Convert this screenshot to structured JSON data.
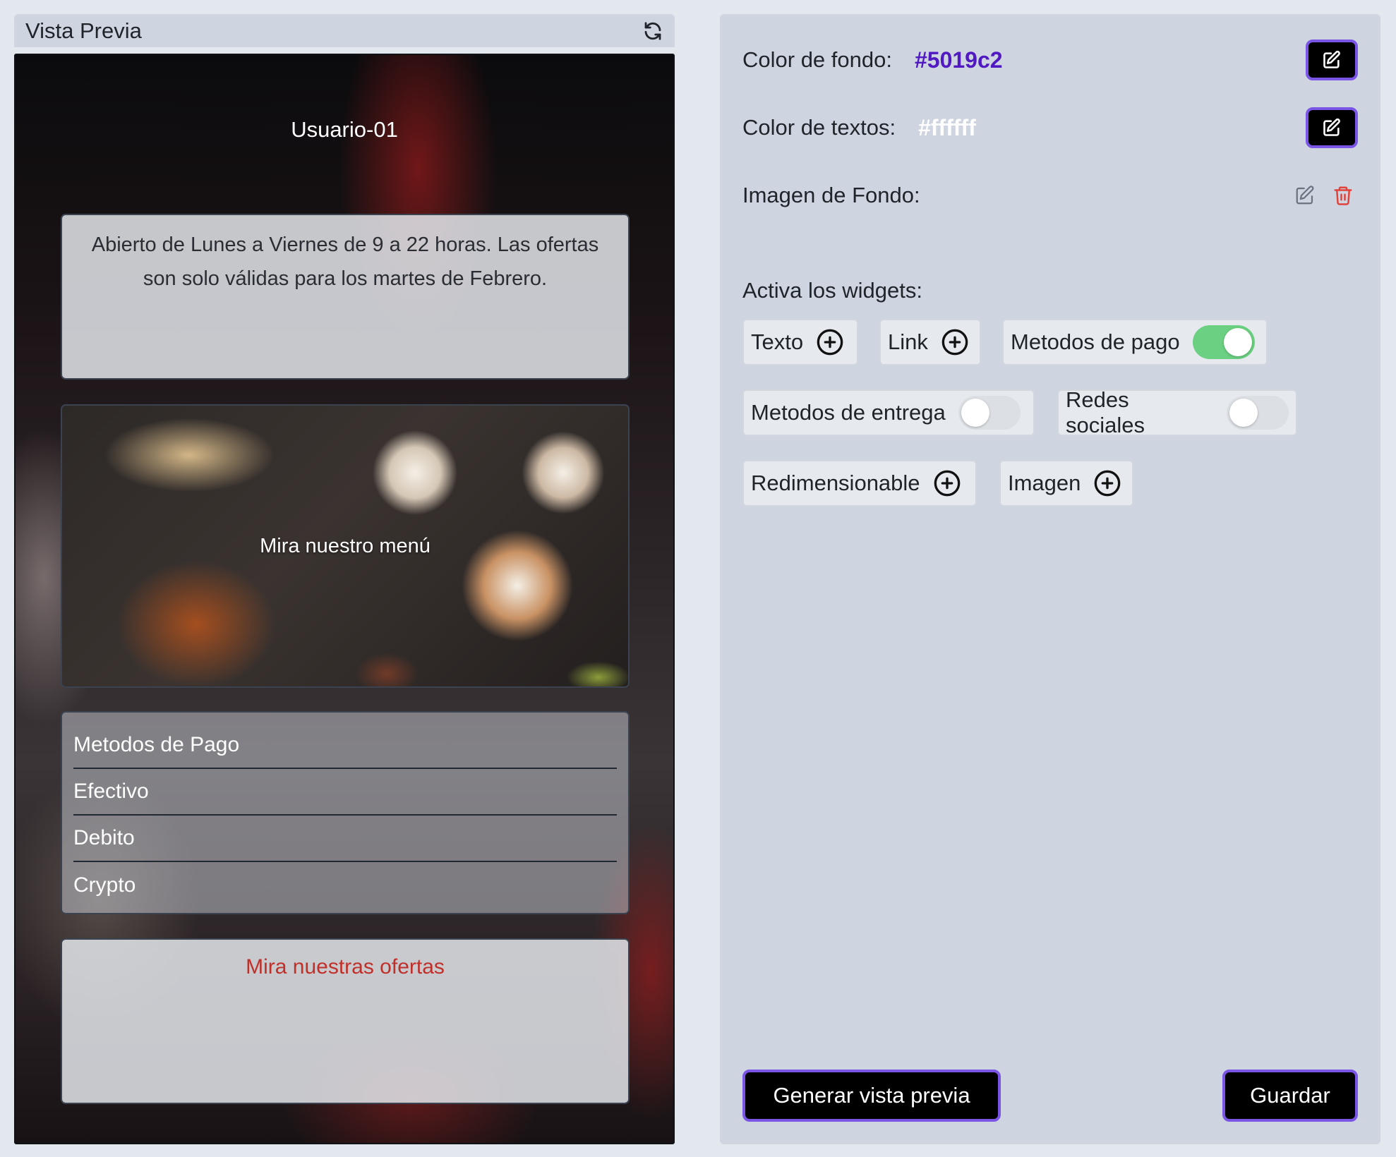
{
  "preview": {
    "title": "Vista Previa",
    "username": "Usuario-01",
    "text_widget": "Abierto de Lunes a Viernes de 9 a 22 horas. Las ofertas son solo válidas para los martes de Febrero.",
    "menu_widget": "Mira nuestro menú",
    "payments": [
      "Metodos de Pago",
      "Efectivo",
      "Debito",
      "Crypto"
    ],
    "offers_widget": "Mira nuestras ofertas"
  },
  "settings": {
    "bg_color_label": "Color de fondo:",
    "bg_color_value": "#5019c2",
    "text_color_label": "Color de textos:",
    "text_color_value": "#ffffff",
    "bg_image_label": "Imagen de Fondo:",
    "widgets_label": "Activa los widgets:",
    "widgets": {
      "texto": "Texto",
      "link": "Link",
      "metodos_pago": "Metodos de pago",
      "metodos_pago_enabled": true,
      "metodos_entrega": "Metodos de entrega",
      "metodos_entrega_enabled": false,
      "redes_sociales": "Redes sociales",
      "redes_sociales_enabled": false,
      "redimensionable": "Redimensionable",
      "imagen": "Imagen"
    },
    "generate_button": "Generar vista previa",
    "save_button": "Guardar"
  },
  "colors": {
    "accent": "#7b56e6",
    "bg_color_swatch": "#5019c2",
    "offers_text": "#c0302a",
    "toggle_on": "#6bd081",
    "delete_icon": "#e0433a"
  },
  "icons": [
    "refresh-icon",
    "edit-icon",
    "pencil-icon",
    "trash-icon",
    "plus-circle-icon"
  ]
}
